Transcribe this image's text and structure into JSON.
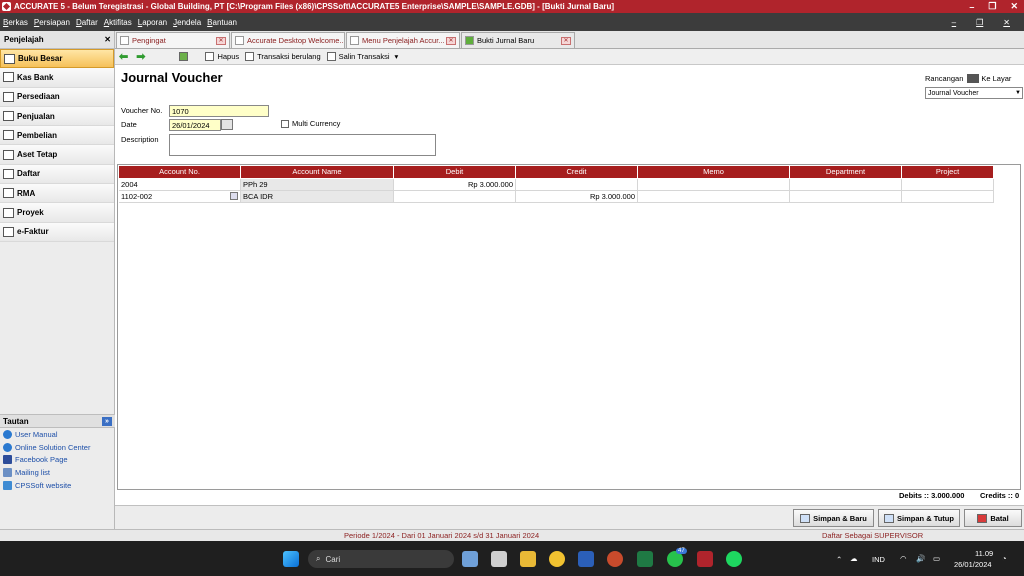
{
  "window": {
    "title": "ACCURATE 5 - Belum Teregistrasi - Global Building, PT  [C:\\Program Files (x86)\\CPSSoft\\ACCURATE5 Enterprise\\SAMPLE\\SAMPLE.GDB] - [Bukti Jurnal Baru]",
    "controls": [
      "–",
      "❐",
      "✕"
    ]
  },
  "menubar": {
    "items": [
      "Berkas",
      "Persiapan",
      "Daftar",
      "Aktifitas",
      "Laporan",
      "Jendela",
      "Bantuan"
    ],
    "mdi_controls": [
      "–",
      "❐",
      "✕"
    ]
  },
  "navigator": {
    "title": "Penjelajah",
    "close": "✕",
    "items": [
      {
        "label": "Buku Besar",
        "active": true
      },
      {
        "label": "Kas Bank"
      },
      {
        "label": "Persediaan"
      },
      {
        "label": "Penjualan"
      },
      {
        "label": "Pembelian"
      },
      {
        "label": "Aset Tetap"
      },
      {
        "label": "Daftar"
      },
      {
        "label": "RMA"
      },
      {
        "label": "Proyek"
      },
      {
        "label": "e-Faktur"
      }
    ],
    "tautan_title": "Tautan",
    "tautan_links": [
      "User Manual",
      "Online Solution Center",
      "Facebook Page",
      "Mailing list",
      "CPSSoft website"
    ]
  },
  "tabs": [
    {
      "label": "Pengingat"
    },
    {
      "label": "Accurate Desktop Welcome..."
    },
    {
      "label": "Menu Penjelajah Accur..."
    },
    {
      "label": "Bukti Jurnal Baru",
      "active": true
    }
  ],
  "toolbar": {
    "back": "⬅",
    "forward": "➡",
    "hapus": "Hapus",
    "transaksi_berulang": "Transaksi berulang",
    "salin_transaksi": "Salin Transaksi",
    "dropdown": "▾"
  },
  "form": {
    "title": "Journal Voucher",
    "rancangan_label": "Rancangan",
    "ke_layar": "Ke Layar",
    "rancangan_value": "Journal Voucher",
    "voucher_label": "Voucher No.",
    "voucher_value": "1070",
    "date_label": "Date",
    "date_value": "26/01/2024",
    "multi_currency": "Multi Currency",
    "description_label": "Description",
    "description_value": ""
  },
  "grid": {
    "columns": [
      "Account No.",
      "Account Name",
      "Debit",
      "Credit",
      "Memo",
      "Department",
      "Project"
    ],
    "rows": [
      {
        "account_no": "2004",
        "account_name": "PPh 29",
        "debit": "Rp 3.000.000",
        "credit": "",
        "memo": "",
        "department": "",
        "project": ""
      },
      {
        "account_no": "1102-002",
        "account_name": "BCA IDR",
        "debit": "",
        "credit": "Rp 3.000.000",
        "memo": "",
        "department": "",
        "project": ""
      }
    ]
  },
  "totals": {
    "debits": "Debits :: 3.000.000",
    "credits": "Credits :: 0"
  },
  "buttons": {
    "save_new": "Simpan & Baru",
    "save_close": "Simpan & Tutup",
    "cancel": "Batal"
  },
  "statusbar": {
    "period": "Periode 1/2024 - Dari 01 Januari 2024 s/d 31 Januari 2024",
    "user": "Daftar Sebagai SUPERVISOR"
  },
  "taskbar": {
    "search_placeholder": "Cari",
    "whatsapp_badge": "47",
    "lang": "IND",
    "time": "11.09",
    "date": "26/01/2024"
  },
  "colors": {
    "titlebar": "#b0242c",
    "grid_header": "#a61e1e",
    "active_nav": "#f6c15a"
  }
}
